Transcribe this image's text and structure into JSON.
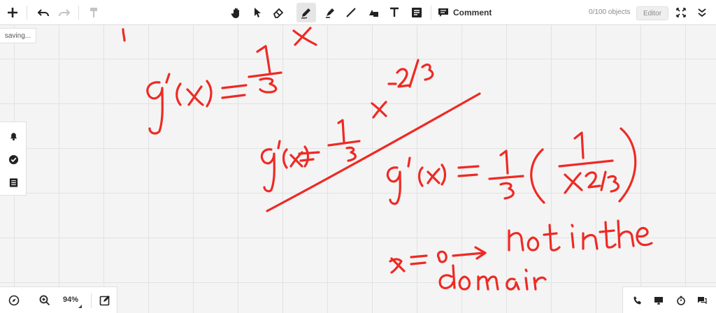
{
  "toolbar": {
    "comment_label": "Comment",
    "objects_count": "0/100 objects",
    "mode_label": "Editor",
    "active_tool": "pen"
  },
  "status": {
    "saving": "saving..."
  },
  "zoom": {
    "level": "94%"
  },
  "ink_color": "#ee2a24",
  "canvas": {
    "handwriting": [
      "x",
      "g'(x) = 1/3 x^-2/3",
      "g'(x) = 1/3 x^-2/3",
      "g'(x) = 1/3 (1 / x^2/3)",
      "x = 0 -> not in the domain"
    ]
  }
}
